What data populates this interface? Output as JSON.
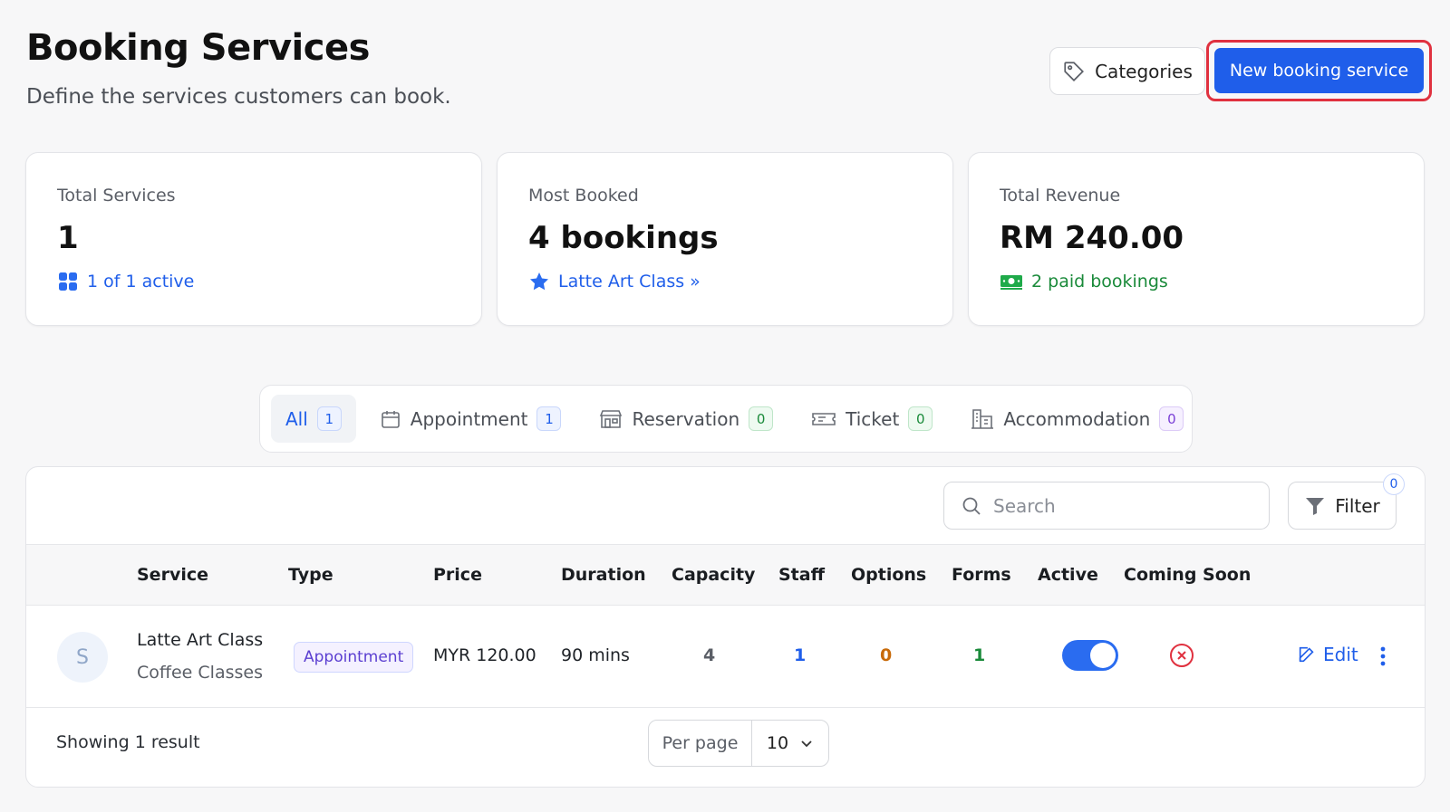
{
  "header": {
    "title": "Booking Services",
    "subtitle": "Define the services customers can book.",
    "categories_label": "Categories",
    "new_service_label": "New booking service"
  },
  "stats": [
    {
      "label": "Total Services",
      "value": "1",
      "sub": "1 of 1 active"
    },
    {
      "label": "Most Booked",
      "value": "4 bookings",
      "sub": "Latte Art Class »"
    },
    {
      "label": "Total Revenue",
      "value": "RM 240.00",
      "sub": "2 paid bookings"
    }
  ],
  "tabs": [
    {
      "label": "All",
      "count": "1"
    },
    {
      "label": "Appointment",
      "count": "1"
    },
    {
      "label": "Reservation",
      "count": "0"
    },
    {
      "label": "Ticket",
      "count": "0"
    },
    {
      "label": "Accommodation",
      "count": "0"
    }
  ],
  "toolbar": {
    "search_placeholder": "Search",
    "filter_label": "Filter",
    "filter_count": "0"
  },
  "table": {
    "columns": [
      "Service",
      "Type",
      "Price",
      "Duration",
      "Capacity",
      "Staff",
      "Options",
      "Forms",
      "Active",
      "Coming Soon"
    ],
    "rows": [
      {
        "avatar": "S",
        "service": "Latte Art Class",
        "category": "Coffee Classes",
        "type": "Appointment",
        "price": "MYR 120.00",
        "duration": "90 mins",
        "capacity": "4",
        "staff": "1",
        "options": "0",
        "forms": "1",
        "active": true,
        "coming_soon": false,
        "edit_label": "Edit"
      }
    ]
  },
  "footer": {
    "result_text": "Showing 1 result",
    "per_page_label": "Per page",
    "per_page_value": "10"
  },
  "colors": {
    "accent": "#1f5eea",
    "highlight_border": "#e0313f",
    "success": "#1a8a3a",
    "warning": "#c86a0a",
    "danger": "#e0313f"
  }
}
